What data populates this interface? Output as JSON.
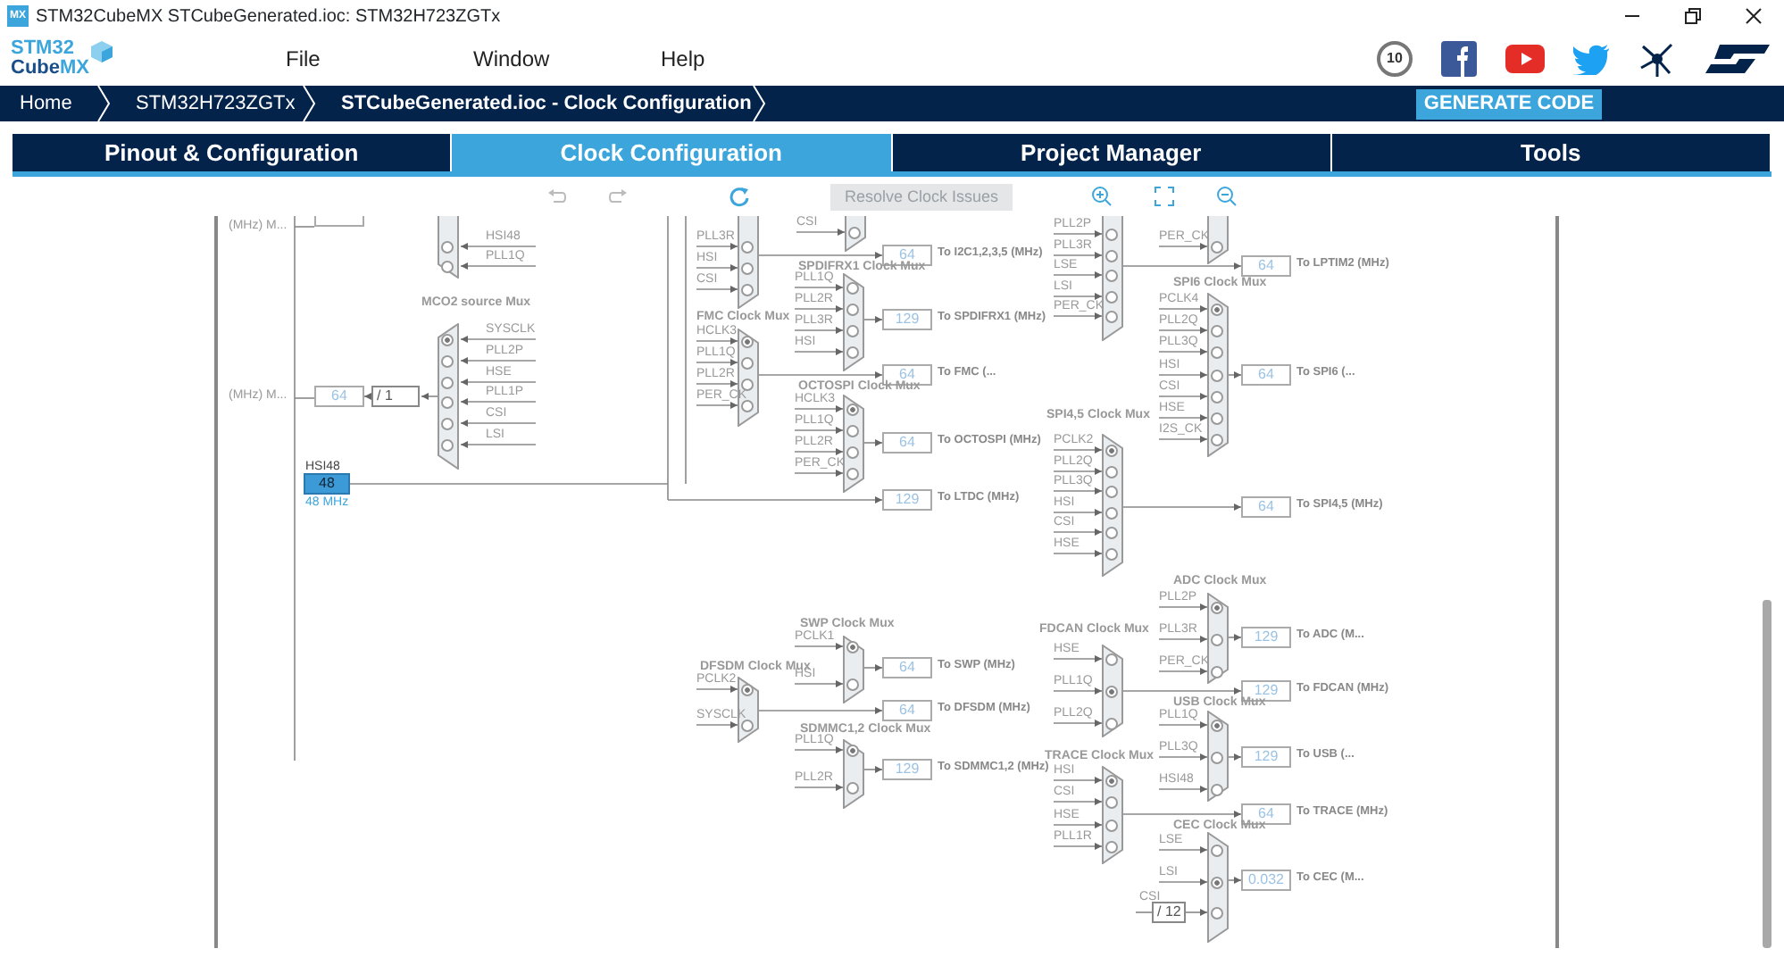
{
  "window": {
    "icon_text": "MX",
    "title": "STM32CubeMX STCubeGenerated.ioc: STM32H723ZGTx"
  },
  "logo": {
    "top": "STM32",
    "bottom_left": "Cube",
    "bottom_right": "MX"
  },
  "menu": [
    "File",
    "Window",
    "Help"
  ],
  "badge": "10",
  "breadcrumb": [
    {
      "label": "Home",
      "current": false
    },
    {
      "label": "STM32H723ZGTx",
      "current": false
    },
    {
      "label": "STCubeGenerated.ioc - Clock Configuration",
      "current": true
    }
  ],
  "generate_button": "GENERATE CODE",
  "tabs": [
    {
      "label": "Pinout & Configuration",
      "selected": false
    },
    {
      "label": "Clock Configuration",
      "selected": true
    },
    {
      "label": "Project Manager",
      "selected": false
    },
    {
      "label": "Tools",
      "selected": false
    }
  ],
  "toolbar": {
    "resolve_button": {
      "label": "Resolve Clock Issues",
      "disabled": true
    }
  },
  "diagram": {
    "top_output_label": "(MHz) M...",
    "muxes": [
      {
        "kind": "mco",
        "inputs": [
          {
            "label": "HSI48",
            "selected": false
          },
          {
            "label": "PLL1Q",
            "selected": false
          }
        ]
      },
      {
        "kind": "mco",
        "title": "MCO2 source Mux",
        "inputs": [
          {
            "label": "SYSCLK",
            "selected": true
          },
          {
            "label": "PLL2P",
            "selected": false
          },
          {
            "label": "HSE",
            "selected": false
          },
          {
            "label": "PLL1P",
            "selected": false
          },
          {
            "label": "CSI",
            "selected": false
          },
          {
            "label": "LSI",
            "selected": false
          }
        ],
        "output": {
          "divider": "/ 1",
          "value": "64",
          "label": "(MHz) M..."
        }
      },
      {
        "kind": "peripheral",
        "inputs": [
          {
            "label": "PLL3R",
            "selected": false
          },
          {
            "label": "HSI",
            "selected": false
          },
          {
            "label": "CSI",
            "selected": false
          }
        ],
        "output": {
          "value": "64",
          "label": "To I2C1,2,3,5 (MHz)"
        }
      },
      {
        "kind": "peripheral",
        "inputs": [
          {
            "label": "CSI",
            "selected": false
          }
        ]
      },
      {
        "kind": "peripheral",
        "title": "SPDIFRX1 Clock Mux",
        "inputs": [
          {
            "label": "PLL1Q",
            "selected": false
          },
          {
            "label": "PLL2R",
            "selected": false
          },
          {
            "label": "PLL3R",
            "selected": false
          },
          {
            "label": "HSI",
            "selected": false
          }
        ],
        "output": {
          "value": "129",
          "label": "To SPDIFRX1 (MHz)"
        }
      },
      {
        "kind": "peripheral",
        "title": "FMC Clock Mux",
        "inputs": [
          {
            "label": "HCLK3",
            "selected": true
          },
          {
            "label": "PLL1Q",
            "selected": false
          },
          {
            "label": "PLL2R",
            "selected": false
          },
          {
            "label": "PER_CK",
            "selected": false
          }
        ],
        "output": {
          "value": "64",
          "label": "To FMC (..."
        }
      },
      {
        "kind": "peripheral",
        "title": "OCTOSPI Clock Mux",
        "inputs": [
          {
            "label": "HCLK3",
            "selected": true
          },
          {
            "label": "PLL1Q",
            "selected": false
          },
          {
            "label": "PLL2R",
            "selected": false
          },
          {
            "label": "PER_CK",
            "selected": false
          }
        ],
        "output": {
          "value": "64",
          "label": "To OCTOSPI (MHz)"
        }
      },
      {
        "kind": "peripheral",
        "title": "SWP Clock Mux",
        "inputs": [
          {
            "label": "PCLK1",
            "selected": true
          },
          {
            "label": "HSI",
            "selected": false
          }
        ],
        "output": {
          "value": "64",
          "label": "To SWP (MHz)"
        }
      },
      {
        "kind": "peripheral",
        "title": "DFSDM Clock Mux",
        "inputs": [
          {
            "label": "PCLK2",
            "selected": true
          },
          {
            "label": "SYSCLK",
            "selected": false
          }
        ],
        "output": {
          "value": "64",
          "label": "To DFSDM (MHz)"
        }
      },
      {
        "kind": "peripheral",
        "title": "SDMMC1,2 Clock Mux",
        "inputs": [
          {
            "label": "PLL1Q",
            "selected": true
          },
          {
            "label": "PLL2R",
            "selected": false
          }
        ],
        "output": {
          "value": "129",
          "label": "To SDMMC1,2 (MHz)"
        }
      },
      {
        "kind": "peripheral",
        "inputs": [
          {
            "label": "PLL2P",
            "selected": false
          },
          {
            "label": "PLL3R",
            "selected": false
          },
          {
            "label": "LSE",
            "selected": false
          },
          {
            "label": "LSI",
            "selected": false
          },
          {
            "label": "PER_CK",
            "selected": false
          }
        ],
        "output": {
          "value": "64",
          "label": "To LPTIM2 (MHz)"
        }
      },
      {
        "kind": "peripheral",
        "inputs": [
          {
            "label": "PER_CK",
            "selected": false
          }
        ]
      },
      {
        "kind": "peripheral",
        "title": "SPI6 Clock Mux",
        "inputs": [
          {
            "label": "PCLK4",
            "selected": true
          },
          {
            "label": "PLL2Q",
            "selected": false
          },
          {
            "label": "PLL3Q",
            "selected": false
          },
          {
            "label": "HSI",
            "selected": false
          },
          {
            "label": "CSI",
            "selected": false
          },
          {
            "label": "HSE",
            "selected": false
          },
          {
            "label": "I2S_CK",
            "selected": false
          }
        ],
        "output": {
          "value": "64",
          "label": "To SPI6 (..."
        }
      },
      {
        "kind": "peripheral",
        "title": "SPI4,5 Clock Mux",
        "inputs": [
          {
            "label": "PCLK2",
            "selected": true
          },
          {
            "label": "PLL2Q",
            "selected": false
          },
          {
            "label": "PLL3Q",
            "selected": false
          },
          {
            "label": "HSI",
            "selected": false
          },
          {
            "label": "CSI",
            "selected": false
          },
          {
            "label": "HSE",
            "selected": false
          }
        ],
        "output": {
          "value": "64",
          "label": "To SPI4,5 (MHz)"
        }
      },
      {
        "kind": "peripheral",
        "title": "ADC Clock Mux",
        "inputs": [
          {
            "label": "PLL2P",
            "selected": true
          },
          {
            "label": "PLL3R",
            "selected": false
          },
          {
            "label": "PER_CK",
            "selected": false
          }
        ],
        "output": {
          "value": "129",
          "label": "To ADC (M..."
        }
      },
      {
        "kind": "peripheral",
        "title": "FDCAN Clock Mux",
        "inputs": [
          {
            "label": "HSE",
            "selected": false
          },
          {
            "label": "PLL1Q",
            "selected": true
          },
          {
            "label": "PLL2Q",
            "selected": false
          }
        ],
        "output": {
          "value": "129",
          "label": "To FDCAN (MHz)"
        }
      },
      {
        "kind": "peripheral",
        "title": "USB Clock Mux",
        "inputs": [
          {
            "label": "PLL1Q",
            "selected": true
          },
          {
            "label": "PLL3Q",
            "selected": false
          },
          {
            "label": "HSI48",
            "selected": false
          }
        ],
        "output": {
          "value": "129",
          "label": "To USB (..."
        }
      },
      {
        "kind": "peripheral",
        "title": "TRACE Clock Mux",
        "inputs": [
          {
            "label": "HSI",
            "selected": true
          },
          {
            "label": "CSI",
            "selected": false
          },
          {
            "label": "HSE",
            "selected": false
          },
          {
            "label": "PLL1R",
            "selected": false
          }
        ],
        "output": {
          "value": "64",
          "label": "To TRACE (MHz)"
        }
      },
      {
        "kind": "peripheral",
        "title": "CEC Clock Mux",
        "inputs": [
          {
            "label": "LSE",
            "selected": false
          },
          {
            "label": "LSI",
            "selected": true
          },
          {
            "label": "CSI",
            "selected": false,
            "divider": "/ 12"
          }
        ],
        "output": {
          "value": "0.032",
          "label": "To CEC (M..."
        }
      }
    ],
    "hsi48": {
      "title": "HSI48",
      "value": "48",
      "reading": "48 MHz"
    },
    "ltdc": {
      "value": "129",
      "label": "To LTDC (MHz)"
    }
  }
}
